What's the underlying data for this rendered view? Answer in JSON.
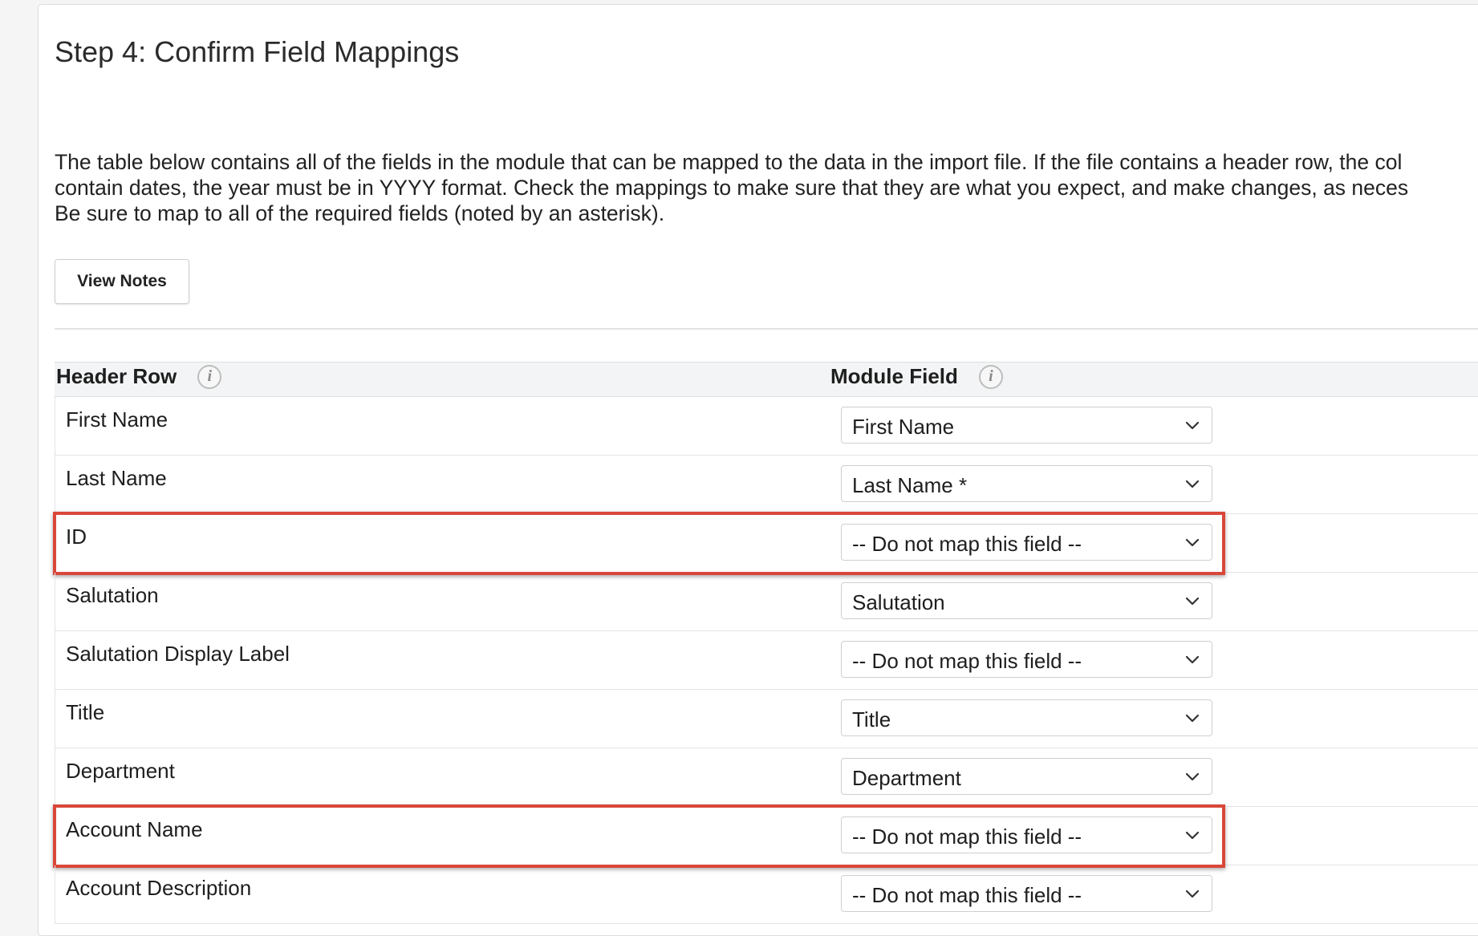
{
  "page": {
    "title": "Step 4: Confirm Field Mappings",
    "description_lines": [
      "The table below contains all of the fields in the module that can be mapped to the data in the import file. If the file contains a header row, the col",
      "contain dates, the year must be in YYYY format. Check the mappings to make sure that they are what you expect, and make changes, as neces",
      "Be sure to map to all of the required fields (noted by an asterisk)."
    ],
    "view_notes_label": "View Notes"
  },
  "table": {
    "header_row_label": "Header Row",
    "module_field_label": "Module Field",
    "info_icon_glyph": "i",
    "rows": [
      {
        "header": "First Name",
        "module_field": "First Name",
        "highlighted": false
      },
      {
        "header": "Last Name",
        "module_field": "Last Name *",
        "highlighted": false
      },
      {
        "header": "ID",
        "module_field": "-- Do not map this field --",
        "highlighted": true
      },
      {
        "header": "Salutation",
        "module_field": "Salutation",
        "highlighted": false
      },
      {
        "header": "Salutation Display Label",
        "module_field": "-- Do not map this field --",
        "highlighted": false
      },
      {
        "header": "Title",
        "module_field": "Title",
        "highlighted": false
      },
      {
        "header": "Department",
        "module_field": "Department",
        "highlighted": false
      },
      {
        "header": "Account Name",
        "module_field": "-- Do not map this field --",
        "highlighted": true
      },
      {
        "header": "Account Description",
        "module_field": "-- Do not map this field --",
        "highlighted": false
      }
    ]
  },
  "colors": {
    "highlight_border": "#d9473a",
    "header_background": "#f3f4f5"
  },
  "icons": {
    "info": "info-icon",
    "dropdown": "chevron-down-icon"
  }
}
